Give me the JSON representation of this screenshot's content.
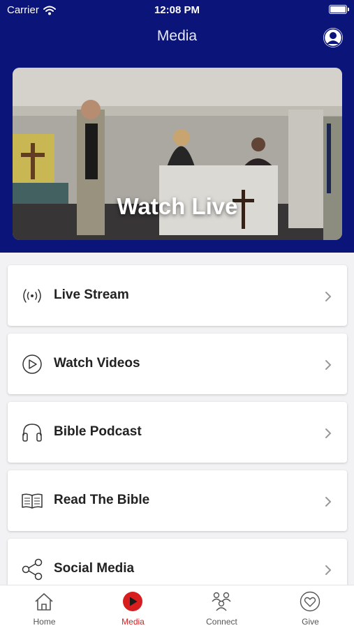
{
  "status_bar": {
    "carrier": "Carrier",
    "time": "12:08 PM"
  },
  "nav": {
    "title": "Media",
    "profile_icon": "person-circle-icon"
  },
  "hero": {
    "label": "Watch Live"
  },
  "menu": [
    {
      "label": "Live Stream",
      "icon": "broadcast-icon"
    },
    {
      "label": "Watch Videos",
      "icon": "play-circle-icon"
    },
    {
      "label": "Bible Podcast",
      "icon": "headphones-icon"
    },
    {
      "label": "Read The Bible",
      "icon": "open-book-icon"
    },
    {
      "label": "Social Media",
      "icon": "share-icon"
    }
  ],
  "tabs": [
    {
      "label": "Home",
      "icon": "home-icon",
      "active": false
    },
    {
      "label": "Media",
      "icon": "play-circle-icon",
      "active": true
    },
    {
      "label": "Connect",
      "icon": "people-icon",
      "active": false
    },
    {
      "label": "Give",
      "icon": "heart-circle-icon",
      "active": false
    }
  ],
  "colors": {
    "header": "#0a1479",
    "accent": "#d71d1d",
    "background": "#f2f2f4"
  }
}
